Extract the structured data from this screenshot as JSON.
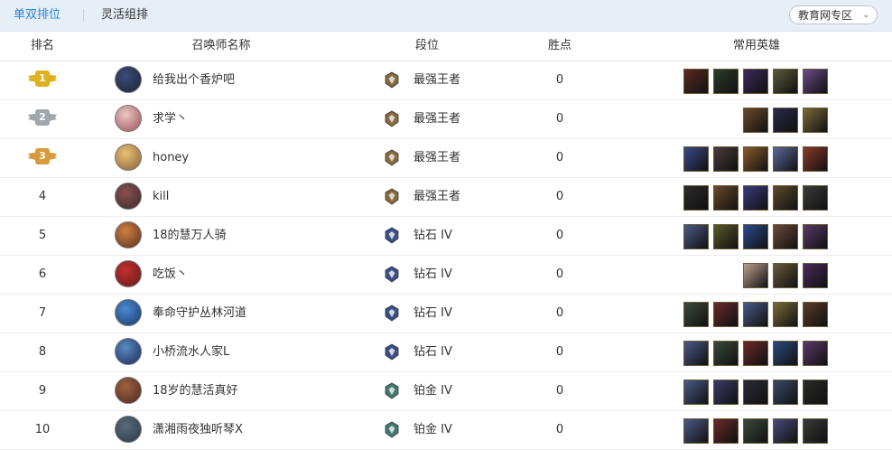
{
  "tabs": [
    {
      "label": "单双排位",
      "active": true
    },
    {
      "label": "灵活组排",
      "active": false
    }
  ],
  "region": {
    "label": "教育网专区"
  },
  "columns": {
    "rank": "排名",
    "name": "召唤师名称",
    "tier": "段位",
    "points": "胜点",
    "heroes": "常用英雄"
  },
  "rows": [
    {
      "rank": "1",
      "medal": "gold",
      "name": "给我出个香炉吧",
      "tier": "最强王者",
      "tier_kind": "challenger",
      "points": "0",
      "avatar": [
        "#3b4d7a",
        "#1b2233"
      ],
      "heroes": [
        "#5a2a22",
        "#2e3b2a",
        "#3b2a5a",
        "#5a5a3a",
        "#6a4a8a"
      ]
    },
    {
      "rank": "2",
      "medal": "silver",
      "name": "求学丶",
      "tier": "最强王者",
      "tier_kind": "challenger",
      "points": "0",
      "avatar": [
        "#e8c8c0",
        "#a05060"
      ],
      "heroes": [
        "#6a4a2a",
        "#2a2a4a",
        "#7a6a3a"
      ]
    },
    {
      "rank": "3",
      "medal": "bronze",
      "name": "honey",
      "tier": "最强王者",
      "tier_kind": "challenger",
      "points": "0",
      "avatar": [
        "#e8c070",
        "#8a6040"
      ],
      "heroes": [
        "#3a4a8a",
        "#4a3a3a",
        "#8a5a2a",
        "#5a6a9a",
        "#8a3a2a"
      ]
    },
    {
      "rank": "4",
      "medal": "",
      "name": "kill",
      "tier": "最强王者",
      "tier_kind": "challenger",
      "points": "0",
      "avatar": [
        "#8a5050",
        "#3a2a2a"
      ],
      "heroes": [
        "#2a2a2a",
        "#6a4a2a",
        "#3a3a7a",
        "#5a4a2a",
        "#3a3a3a"
      ]
    },
    {
      "rank": "5",
      "medal": "",
      "name": "18的慧万人骑",
      "tier": "钻石 IV",
      "tier_kind": "diamond",
      "points": "0",
      "avatar": [
        "#d08040",
        "#5a3020"
      ],
      "heroes": [
        "#4a5a8a",
        "#5a5a2a",
        "#2a4a8a",
        "#6a4a3a",
        "#5a3a6a"
      ]
    },
    {
      "rank": "6",
      "medal": "",
      "name": "吃饭丶",
      "tier": "钻石 IV",
      "tier_kind": "diamond",
      "points": "0",
      "avatar": [
        "#c03030",
        "#6a1a1a"
      ],
      "heroes": [
        "#c0a090",
        "#6a5a3a",
        "#4a2a5a"
      ]
    },
    {
      "rank": "7",
      "medal": "",
      "name": "奉命守护丛林河道",
      "tier": "钻石 IV",
      "tier_kind": "diamond",
      "points": "0",
      "avatar": [
        "#4a8ad0",
        "#1a3a6a"
      ],
      "heroes": [
        "#3a4a3a",
        "#6a2a2a",
        "#4a5a8a",
        "#7a6a3a",
        "#5a3a2a"
      ]
    },
    {
      "rank": "8",
      "medal": "",
      "name": "小桥流水人家L",
      "tier": "钻石 IV",
      "tier_kind": "diamond",
      "points": "0",
      "avatar": [
        "#5a8ac0",
        "#1a2a5a"
      ],
      "heroes": [
        "#4a5a8a",
        "#3a4a3a",
        "#6a2a2a",
        "#2a4a7a",
        "#5a3a6a"
      ]
    },
    {
      "rank": "9",
      "medal": "",
      "name": "18岁的慧活真好",
      "tier": "铂金 IV",
      "tier_kind": "platinum",
      "points": "0",
      "avatar": [
        "#a06040",
        "#4a2a20"
      ],
      "heroes": [
        "#4a5a8a",
        "#3a3a6a",
        "#2a2a3a",
        "#3a4a6a",
        "#2a2a2a"
      ]
    },
    {
      "rank": "10",
      "medal": "",
      "name": "潇湘雨夜独听琴X",
      "tier": "铂金 IV",
      "tier_kind": "platinum",
      "points": "0",
      "avatar": [
        "#5a6a7a",
        "#2a3a4a"
      ],
      "heroes": [
        "#4a5a8a",
        "#6a2a2a",
        "#3a4a3a",
        "#4a4a7a",
        "#3a3a3a"
      ]
    }
  ],
  "colors": {
    "accent": "#2a86d6",
    "gold": "#e0b020",
    "silver": "#a0a6ad",
    "bronze": "#d89a3a",
    "challenger": "#8a6a3a",
    "diamond": "#3a4f8c",
    "platinum": "#3f7a72"
  }
}
